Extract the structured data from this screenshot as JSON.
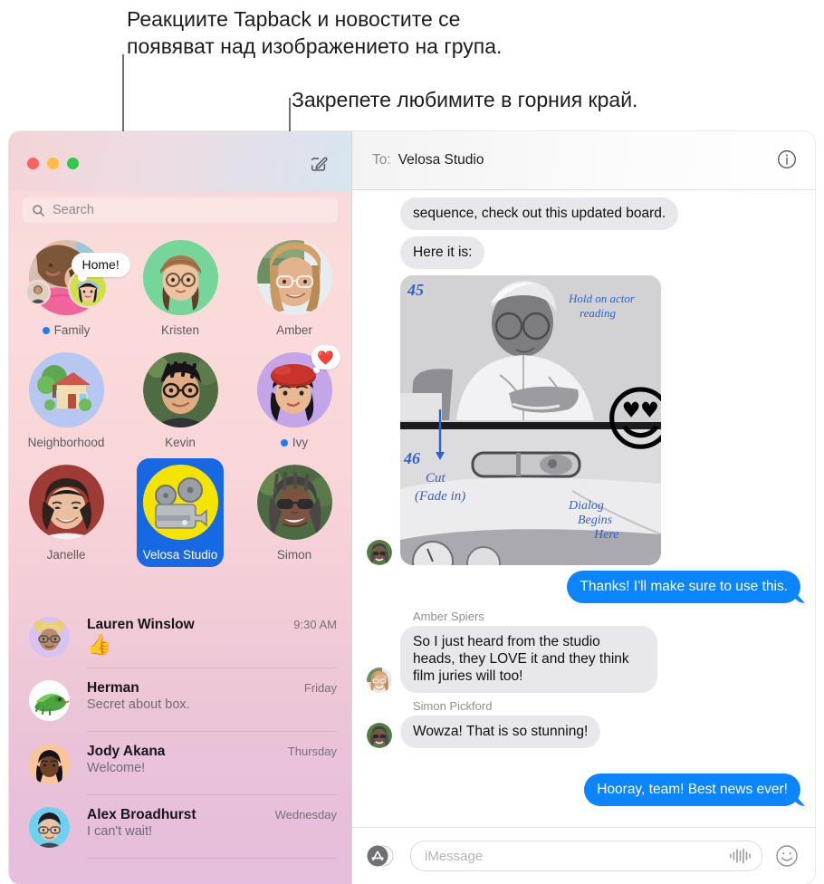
{
  "callouts": {
    "tapback_note": "Реакциите Tapback и новостите се\nпоявяват над изображението на група.",
    "pin_note": "Закрепете любимите в горния край."
  },
  "window": {
    "traffic_lights": [
      "close",
      "minimize",
      "zoom"
    ],
    "compose_icon": "compose-pencil-square-icon"
  },
  "search": {
    "placeholder": "Search",
    "icon": "search-icon"
  },
  "pinned": [
    {
      "label": "Family",
      "unread": true,
      "kind": "photo-group",
      "tapback": "Home!",
      "emoji": ""
    },
    {
      "label": "Kristen",
      "unread": false,
      "kind": "memoji",
      "tapback": "",
      "emoji": "👩🏻"
    },
    {
      "label": "Amber",
      "unread": false,
      "kind": "photo",
      "tapback": "",
      "emoji": ""
    },
    {
      "label": "Neighborhood",
      "unread": false,
      "kind": "emoji",
      "tapback": "",
      "emoji": "🏡"
    },
    {
      "label": "Kevin",
      "unread": false,
      "kind": "photo",
      "tapback": "",
      "emoji": ""
    },
    {
      "label": "Ivy",
      "unread": true,
      "kind": "memoji",
      "tapback": "❤️",
      "emoji": "👩🏻"
    },
    {
      "label": "Janelle",
      "unread": false,
      "kind": "photo",
      "tapback": "",
      "emoji": ""
    },
    {
      "label": "Velosa Studio",
      "unread": false,
      "kind": "emoji",
      "tapback": "",
      "emoji": "📽"
    },
    {
      "label": "Simon",
      "unread": false,
      "kind": "photo",
      "tapback": "",
      "emoji": ""
    }
  ],
  "pinned_selected": "Velosa Studio",
  "conversations": [
    {
      "name": "Lauren Winslow",
      "time": "9:30 AM",
      "preview": "👍",
      "avatar_emoji": "🧑‍🦰",
      "is_emoji_preview": true
    },
    {
      "name": "Herman",
      "time": "Friday",
      "preview": "Secret about box.",
      "avatar_emoji": "🦎",
      "is_emoji_preview": false
    },
    {
      "name": "Jody Akana",
      "time": "Thursday",
      "preview": "Welcome!",
      "avatar_emoji": "👩🏿",
      "is_emoji_preview": false
    },
    {
      "name": "Alex Broadhurst",
      "time": "Wednesday",
      "preview": "I can't wait!",
      "avatar_emoji": "🧑🏻",
      "is_emoji_preview": false
    }
  ],
  "main_header": {
    "to_label": "To:",
    "to_value": "Velosa Studio",
    "info_icon": "info-circle-icon"
  },
  "thread": {
    "messages": [
      {
        "type": "in",
        "text": "sequence, check out this updated board."
      },
      {
        "type": "in",
        "text": "Here it is:"
      },
      {
        "type": "attachment",
        "text": "",
        "caption": "storyboard-sketch"
      },
      {
        "type": "out",
        "text": "Thanks! I'll make sure to use this."
      },
      {
        "type": "in",
        "sender": "Amber Spiers",
        "text": "So I just heard from the studio heads, they LOVE it and they think film juries will too!"
      },
      {
        "type": "in",
        "sender": "Simon Pickford",
        "text": "Wowza! That is so stunning!"
      },
      {
        "type": "out",
        "text": "Hooray, team! Best news ever!"
      }
    ],
    "storyboard_annotations": {
      "frame_top": "45",
      "frame_bottom": "46",
      "note_top_right": "Hold on actor reading",
      "note_left": "Cut (Fade in)",
      "note_bottom_right": "Dialog Begins Here"
    },
    "reaction_memoji": "😍"
  },
  "composer": {
    "apps_icon": "app-store-icon",
    "placeholder": "iMessage",
    "audio_icon": "audio-waveform-icon",
    "emoji_icon": "smiley-face-icon"
  },
  "colors": {
    "bubble_outgoing": "#0b84fe",
    "bubble_incoming": "#e8e8ec",
    "selected_pin": "#1668e3",
    "unread_dot": "#1a7cf7",
    "sidebar_top": "#f6d7d8",
    "sidebar_bottom": "#e4bedd"
  }
}
